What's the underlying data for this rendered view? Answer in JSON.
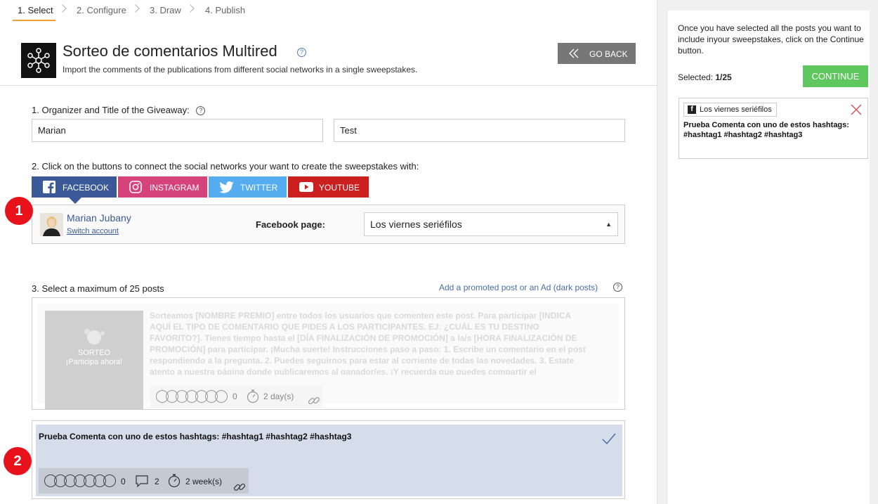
{
  "steps": [
    {
      "label": "1. Select"
    },
    {
      "label": "2. Configure"
    },
    {
      "label": "3. Draw"
    },
    {
      "label": "4. Publish"
    }
  ],
  "header": {
    "title": "Sorteo de comentarios Multired",
    "subtitle": "Import the comments of the publications from different social networks in a single sweepstakes.",
    "go_back": "GO BACK",
    "help": "?"
  },
  "section1": {
    "label": "1.  Organizer and Title of the Giveaway:",
    "organizer_value": "Marian",
    "title_value": "Test"
  },
  "section2": {
    "label": "2. Click on the buttons to connect the social networks your want to create the sweepstakes with:",
    "networks": {
      "facebook": "FACEBOOK",
      "instagram": "INSTAGRAM",
      "twitter": "TWITTER",
      "youtube": "YOUTUBE"
    },
    "account_name": "Marian Jubany",
    "switch_account": "Switch account",
    "facebook_page_label": "Facebook page:",
    "facebook_page_value": "Los viernes seriéfilos"
  },
  "badges": {
    "one": "1",
    "two": "2"
  },
  "section3": {
    "label": "3. Select a maximum of 25 posts",
    "promo_link": "Add a promoted post or an Ad (dark posts)",
    "posts": [
      {
        "image_line1": "SORTEO",
        "image_line2": "¡Participa ahora!",
        "text": "Sorteamos [NOMBRE PREMIO] entre todos los usuarios que comenten este post. Para participar [INDICA AQUÍ EL TIPO DE COMENTARIO QUE PIDES A LOS PARTICIPANTES. EJ: ¿CUÁL ES TU DESTINO FAVORITO?]. Tienes tiempo hasta el [DÍA FINALIZACIÓN DE PROMOCIÓN] a la/s [HORA FINALIZACIÓN DE PROMOCIÓN] para participar. ¡Mucha suerte! Instrucciones paso a paso: 1. Escribe un comentario en el post respondiendo a la pregunta. 2. Puedes seguirnos para estar al corriente de todas las novedades. 3. Estate atento a nuestra página donde publicaremos al ganador/es. ¡Y recuerda que puedes compartir el",
        "reactions": "0",
        "age": "2 day(s)"
      },
      {
        "text": "Prueba Comenta con uno de estos hashtags: #hashtag1 #hashtag2 #hashtag3",
        "reactions": "0",
        "comments": "2",
        "age": "2 week(s)",
        "selected": true
      }
    ]
  },
  "sidebar": {
    "instructions": "Once you have selected all the posts you want to include inyour sweepstakes, click on the Continue button.",
    "selected_label": "Selected: ",
    "selected_count": "1/25",
    "continue": "CONTINUE",
    "card_tag": "Los viernes seriéfilos",
    "card_title": "Prueba Comenta con uno de estos hashtags: #hashtag1 #hashtag2 #hashtag3"
  },
  "colors": {
    "facebook": "#3b5998",
    "instagram": "#d6437a",
    "twitter": "#55acee",
    "youtube": "#cc1f1f",
    "continue": "#5ec85e",
    "badge": "#e8121a",
    "selected_post": "#d5dcea",
    "step_active_underline": "#f0a030"
  }
}
